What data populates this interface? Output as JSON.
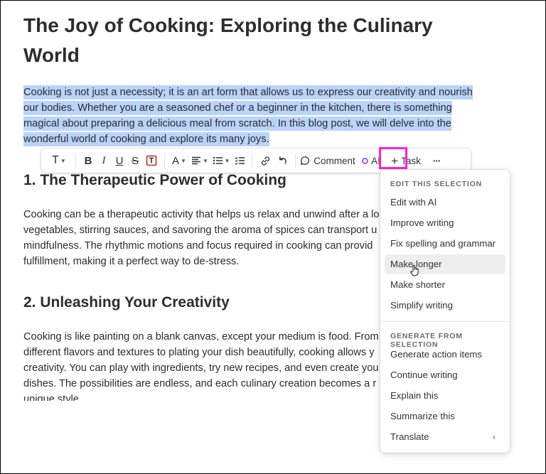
{
  "document": {
    "title": "The Joy of Cooking: Exploring the Culinary World",
    "intro_lines": [
      "Cooking is not just a necessity; it is an art form that allows us to express our creativity and nourish",
      "our bodies. Whether you are a seasoned chef or a beginner in the kitchen, there is something",
      "magical about preparing a delicious meal from scratch. In this blog post, we will delve into the",
      "wonderful world of cooking and explore its many joys."
    ],
    "section1_heading": "1. The Therapeutic Power of Cooking",
    "section1_lines": [
      "Cooking can be a therapeutic activity that helps us relax and unwind after a lo",
      "vegetables, stirring sauces, and savoring the aroma of spices can transport u",
      "mindfulness. The rhythmic motions and focus required in cooking can provid",
      "fulfillment, making it a perfect way to de-stress."
    ],
    "section2_heading": "2. Unleashing Your Creativity",
    "section2_lines": [
      "Cooking is like painting on a blank canvas, except your medium is food. From",
      "different flavors and textures to plating your dish beautifully, cooking allows y",
      "creativity. You can play with ingredients, try new recipes, and even create you",
      "dishes. The possibilities are endless, and each culinary creation becomes a r",
      "unique style."
    ]
  },
  "toolbar": {
    "text_style_glyph": "T",
    "bold_glyph": "B",
    "italic_glyph": "I",
    "underline_glyph": "U",
    "strike_glyph": "S",
    "font_color_glyph": "A",
    "comment_label": "Comment",
    "ai_label": "AI",
    "task_label": "Task",
    "more_glyph": "···"
  },
  "ai_menu": {
    "edit_section_label": "EDIT THIS SELECTION",
    "edit_items": [
      "Edit with AI",
      "Improve writing",
      "Fix spelling and grammar",
      "Make longer",
      "Make shorter",
      "Simplify writing"
    ],
    "generate_section_label": "GENERATE FROM SELECTION",
    "generate_items": [
      "Generate action items",
      "Continue writing",
      "Explain this",
      "Summarize this",
      "Translate"
    ],
    "hovered_item": "Make longer"
  },
  "colors": {
    "selection": "#b9d3fb",
    "highlight_box": "#ff22cc",
    "ai_dot": "#a259ff"
  }
}
